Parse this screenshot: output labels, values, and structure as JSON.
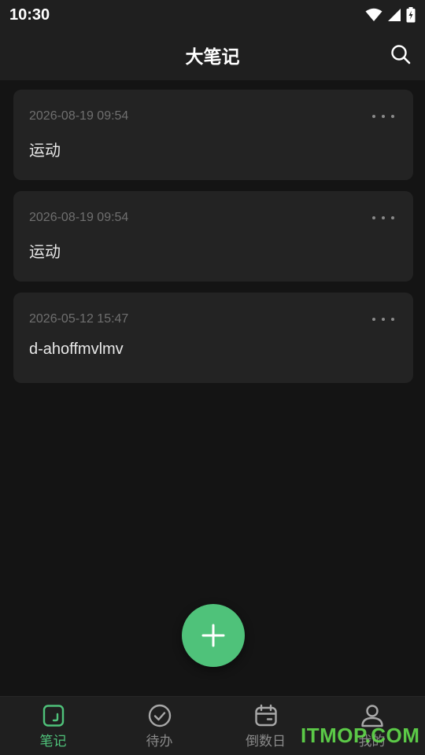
{
  "status_bar": {
    "time": "10:30"
  },
  "app_bar": {
    "title": "大笔记"
  },
  "notes": [
    {
      "date": "2026-08-19 09:54",
      "title": "运动"
    },
    {
      "date": "2026-08-19 09:54",
      "title": "运动"
    },
    {
      "date": "2026-05-12 15:47",
      "title": "d-ahoffmvlmv"
    }
  ],
  "bottom_nav": {
    "items": [
      {
        "label": "笔记",
        "icon": "note-icon",
        "active": true
      },
      {
        "label": "待办",
        "icon": "check-circle-icon",
        "active": false
      },
      {
        "label": "倒数日",
        "icon": "calendar-icon",
        "active": false
      },
      {
        "label": "我的",
        "icon": "person-icon",
        "active": false
      }
    ]
  },
  "watermark": "ITMOP.COM",
  "colors": {
    "accent": "#4fc27a",
    "background": "#141414",
    "surface": "#1f1f1f",
    "card": "#232323"
  }
}
